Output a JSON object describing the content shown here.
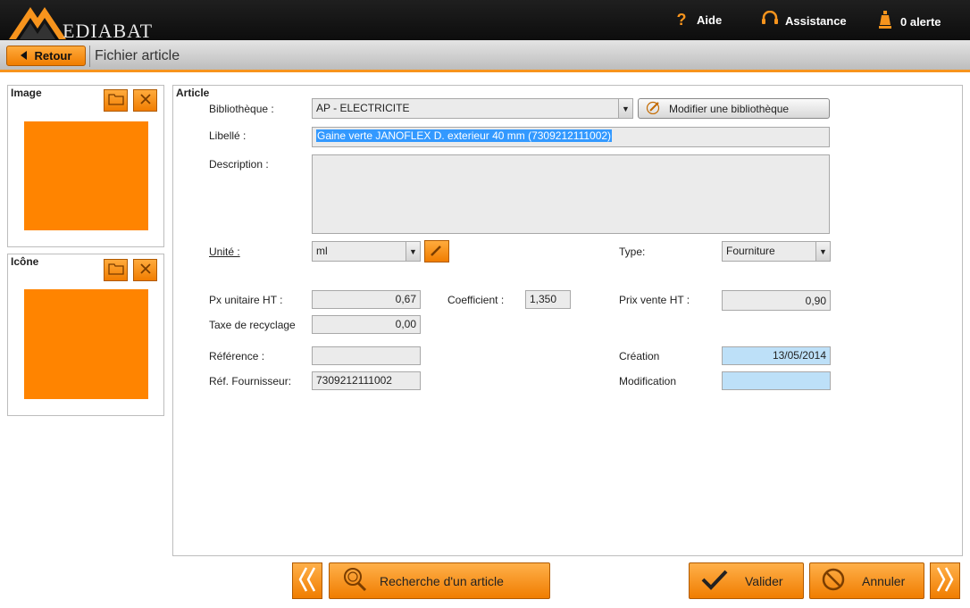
{
  "header": {
    "logo_text": "EDIABAT",
    "aide_label": "Aide",
    "assistance_label": "Assistance",
    "alerte_label": "0 alerte"
  },
  "nav": {
    "back_label": "Retour",
    "title": "Fichier article"
  },
  "image_panel": {
    "title": "Image"
  },
  "icone_panel": {
    "title": "Icône"
  },
  "article": {
    "title": "Article",
    "bibliotheque_label": "Bibliothèque :",
    "bibliotheque_value": "AP - ELECTRICITE",
    "modifier_biblio_label": "Modifier une bibliothèque",
    "libelle_label": "Libellé :",
    "libelle_value": "Gaine verte JANOFLEX D. exterieur 40 mm (7309212111002)",
    "description_label": "Description :",
    "description_value": "",
    "unite_label": "Unité :",
    "unite_value": "ml",
    "type_label": "Type:",
    "type_value": "Fourniture",
    "px_unitaire_label": "Px unitaire HT :",
    "px_unitaire_value": "0,67",
    "coefficient_label": "Coefficient :",
    "coefficient_value": "1,350",
    "prix_vente_label": "Prix vente HT :",
    "prix_vente_value": "0,90",
    "taxe_label": "Taxe de recyclage",
    "taxe_value": "0,00",
    "reference_label": "Référence :",
    "reference_value": "",
    "ref_fournisseur_label": "Réf. Fournisseur:",
    "ref_fournisseur_value": "7309212111002",
    "creation_label": "Création",
    "creation_value": "13/05/2014",
    "modification_label": "Modification",
    "modification_value": ""
  },
  "footer": {
    "recherche_label": "Recherche d'un article",
    "valider_label": "Valider",
    "annuler_label": "Annuler"
  },
  "colors": {
    "accent": "#f7941d",
    "button_orange": "#ff8400",
    "date_field": "#bde0f8"
  }
}
